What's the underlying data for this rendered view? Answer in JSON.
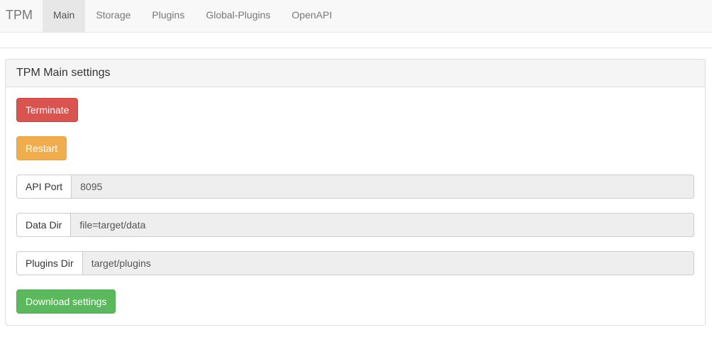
{
  "navbar": {
    "brand": "TPM",
    "items": [
      {
        "label": "Main",
        "active": true
      },
      {
        "label": "Storage",
        "active": false
      },
      {
        "label": "Plugins",
        "active": false
      },
      {
        "label": "Global-Plugins",
        "active": false
      },
      {
        "label": "OpenAPI",
        "active": false
      }
    ]
  },
  "panel": {
    "title": "TPM Main settings",
    "terminate_label": "Terminate",
    "restart_label": "Restart",
    "fields": [
      {
        "label": "API Port",
        "value": "8095"
      },
      {
        "label": "Data Dir",
        "value": "file=target/data"
      },
      {
        "label": "Plugins Dir",
        "value": "target/plugins"
      }
    ],
    "download_label": "Download settings"
  },
  "colors": {
    "danger": "#d9534f",
    "warning": "#f0ad4e",
    "success": "#5cb85c",
    "navbar_bg": "#f8f8f8",
    "readonly_bg": "#eeeeee"
  }
}
